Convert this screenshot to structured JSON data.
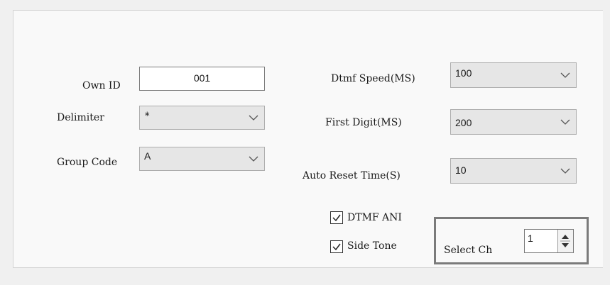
{
  "form": {
    "own_id": {
      "label": "Own ID",
      "value": "001"
    },
    "delimiter": {
      "label": "Delimiter",
      "value": "*"
    },
    "group_code": {
      "label": "Group Code",
      "value": "A"
    },
    "dtmf_speed": {
      "label": "Dtmf Speed(MS)",
      "value": "100"
    },
    "first_digit": {
      "label": "First Digit(MS)",
      "value": "200"
    },
    "auto_reset": {
      "label": "Auto Reset Time(S)",
      "value": "10"
    },
    "dtmf_ani": {
      "label": "DTMF ANI",
      "checked": true
    },
    "side_tone": {
      "label": "Side Tone",
      "checked": true
    },
    "select_ch": {
      "label": "Select Ch",
      "value": "1"
    }
  },
  "icons": {
    "dropdown": "chevron-down-icon",
    "check": "checkmark-icon",
    "spin_up": "spin-up-icon",
    "spin_down": "spin-down-icon"
  },
  "colors": {
    "panel": "#f9f9f9",
    "combo_bg": "#e6e6e6",
    "highlight_border": "#7b7b7b"
  }
}
